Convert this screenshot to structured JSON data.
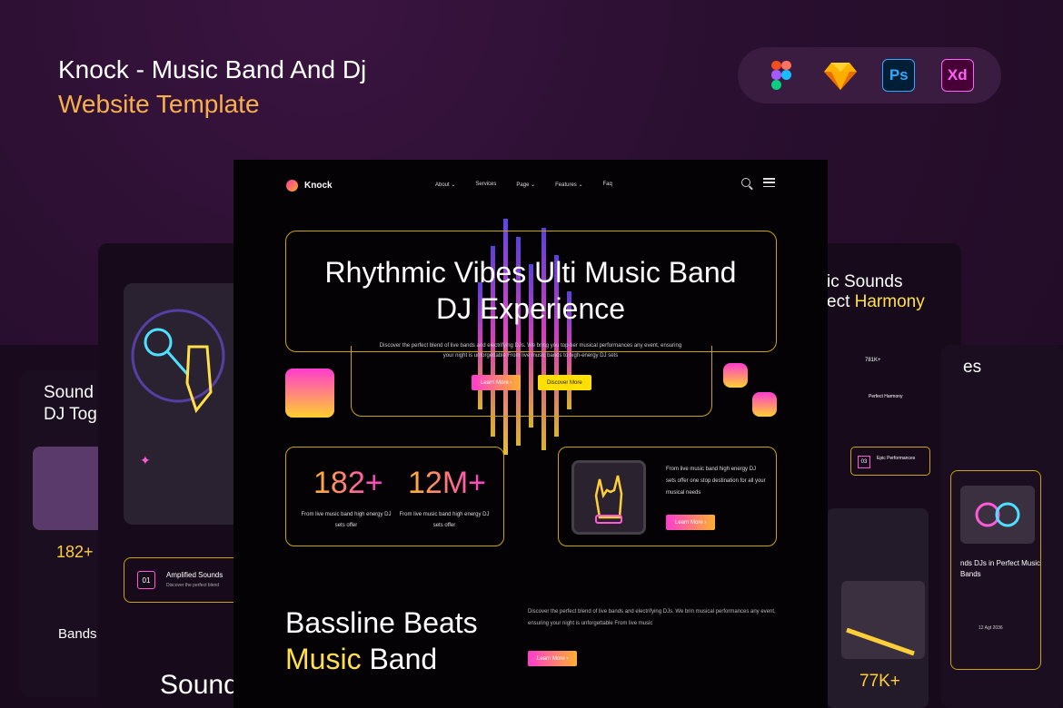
{
  "promo": {
    "title_line1": "Knock - Music Band And Dj",
    "title_line2": "Website Template",
    "tools": [
      {
        "name": "figma-icon"
      },
      {
        "name": "sketch-icon"
      },
      {
        "name": "photoshop-icon",
        "label": "Ps"
      },
      {
        "name": "xd-icon",
        "label": "Xd"
      }
    ]
  },
  "nav": {
    "brand": "Knock",
    "items": [
      "About",
      "Services",
      "Page",
      "Features",
      "Faq"
    ]
  },
  "hero": {
    "title": "Rhythmic Vibes Ulti Music Band DJ Experience",
    "subtitle": "Discover the perfect blend of live bands and electrifying DJs. We bring you top-tier musical performances any event, ensuring your night is unforgettable From live music bands to high-energy DJ sets",
    "btn_learn": "Learn More",
    "btn_discover": "Discover More"
  },
  "stats": [
    {
      "value": "182+",
      "text": "From live music band high energy DJ sets offer"
    },
    {
      "value": "12M+",
      "text": "From live music band high energy DJ sets offer"
    }
  ],
  "promo_card": {
    "text": "From live music band high energy DJ sets offer one stop destination for all your musical needs",
    "btn": "Learn More"
  },
  "bottom": {
    "title_a": "Bassline Beats",
    "title_b1": "Music",
    "title_b2": "Band",
    "subtitle": "Discover the perfect blend of live bands and electrifying DJs. We brin musical performances any event, ensuring your night is unforgettable From live music",
    "btn": "Learn More"
  },
  "left_mock": {
    "heading_a": "Sound",
    "heading_b": "DJ Tog",
    "stat": "182+",
    "feature_num": "01",
    "feature_title": "Amplified Sounds",
    "feature_desc": "Discover the perfect blend",
    "bands": "Bands",
    "sound_bottom": "Sound"
  },
  "right_mock": {
    "heading_a": "ic Sounds",
    "heading_b1": "ect",
    "heading_b2": "Harmony",
    "count": "781K+",
    "perfect": "Perfect Harmony",
    "feature_num": "03",
    "feature_title": "Epic Performances",
    "stat": "77K+",
    "back_heading": "es",
    "back_title": "nds DJs in Perfect Music Bands",
    "back_date": "12 Agt 2036"
  }
}
